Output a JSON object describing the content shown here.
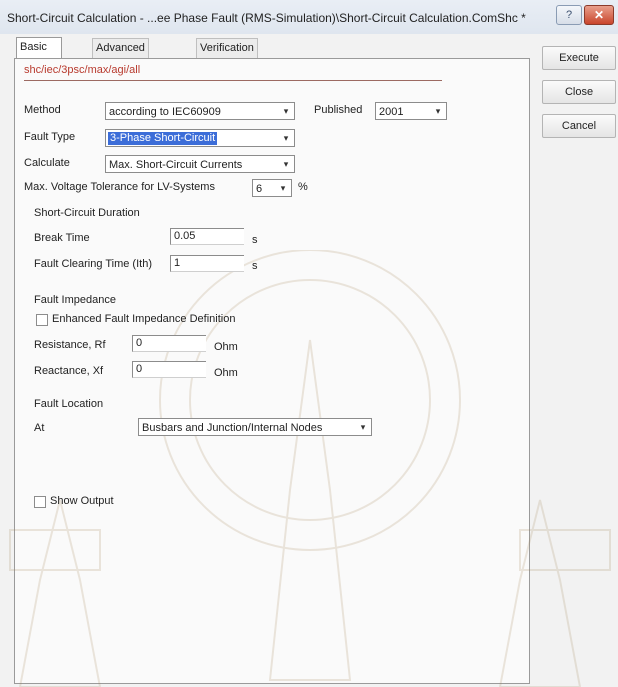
{
  "window": {
    "title": "Short-Circuit Calculation - ...ee Phase Fault (RMS-Simulation)\\Short-Circuit Calculation.ComShc *",
    "help_glyph": "?",
    "close_glyph": "✕"
  },
  "tabs": [
    {
      "label": "Basic Options",
      "active": true
    },
    {
      "label": "Advanced Options",
      "active": false
    },
    {
      "label": "Verification",
      "active": false
    }
  ],
  "side_buttons": {
    "execute": "Execute",
    "close": "Close",
    "cancel": "Cancel"
  },
  "path": "shc/iec/3psc/max/agi/all",
  "form": {
    "method": {
      "label": "Method",
      "value": "according to IEC60909"
    },
    "published": {
      "label": "Published",
      "value": "2001"
    },
    "fault_type": {
      "label": "Fault Type",
      "value": "3-Phase Short-Circuit"
    },
    "calculate": {
      "label": "Calculate",
      "value": "Max. Short-Circuit Currents"
    },
    "voltage_tolerance": {
      "label": "Max. Voltage Tolerance for LV-Systems",
      "value": "6",
      "unit": "%"
    }
  },
  "duration": {
    "title": "Short-Circuit Duration",
    "break_time": {
      "label": "Break Time",
      "value": "0.05",
      "unit": "s"
    },
    "clearing_time": {
      "label": "Fault Clearing Time (Ith)",
      "value": "1",
      "unit": "s"
    }
  },
  "impedance": {
    "title": "Fault Impedance",
    "enhanced_label": "Enhanced Fault Impedance Definition",
    "enhanced_checked": false,
    "resistance": {
      "label": "Resistance, Rf",
      "value": "0",
      "unit": "Ohm"
    },
    "reactance": {
      "label": "Reactance, Xf",
      "value": "0",
      "unit": "Ohm"
    }
  },
  "location": {
    "title": "Fault Location",
    "at_label": "At",
    "at_value": "Busbars and Junction/Internal Nodes"
  },
  "show_output": {
    "label": "Show Output",
    "checked": false
  },
  "colors": {
    "path_text": "#b83a2e",
    "selection": "#3c6dd8",
    "close_button": "#c9452c"
  },
  "icons": {
    "dropdown": "▾"
  }
}
